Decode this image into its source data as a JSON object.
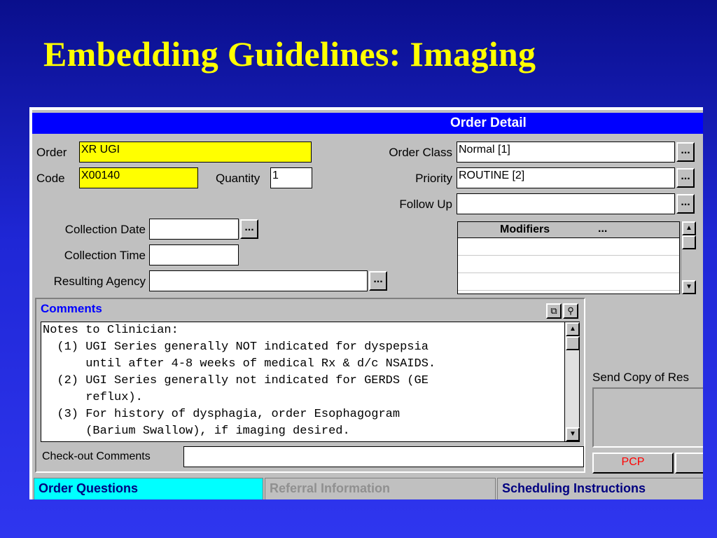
{
  "slide": {
    "title": "Embedding Guidelines: Imaging"
  },
  "window": {
    "title": "Order Detail",
    "order": {
      "label": "Order",
      "value": "XR UGI"
    },
    "code": {
      "label": "Code",
      "value": "X00140"
    },
    "quantity": {
      "label": "Quantity",
      "value": "1"
    },
    "order_class": {
      "label": "Order Class",
      "value": "Normal [1]"
    },
    "priority": {
      "label": "Priority",
      "value": "ROUTINE [2]"
    },
    "follow_up": {
      "label": "Follow Up",
      "value": ""
    },
    "collection_date": {
      "label": "Collection Date",
      "value": ""
    },
    "collection_time": {
      "label": "Collection Time",
      "value": ""
    },
    "resulting_agency": {
      "label": "Resulting Agency",
      "value": ""
    },
    "ellipsis": "...",
    "modifiers": {
      "header": "Modifiers",
      "header_dots": "..."
    },
    "comments": {
      "title": "Comments",
      "text": "Notes to Clinician:\n  (1) UGI Series generally NOT indicated for dyspepsia\n      until after 4-8 weeks of medical Rx & d/c NSAIDS.\n  (2) UGI Series generally not indicated for GERDS (GE\n      reflux).\n  (3) For history of dysphagia, order Esophagogram\n      (Barium Swallow), if imaging desired."
    },
    "checkout_comments": {
      "label": "Check-out Comments",
      "value": ""
    },
    "send_copy": {
      "label": "Send Copy of Res"
    },
    "pcp_button": "PCP",
    "tabs": [
      {
        "label": "Order Questions",
        "state": "active"
      },
      {
        "label": "Referral Information",
        "state": "disabled"
      },
      {
        "label": "Scheduling Instructions",
        "state": "normal"
      }
    ]
  },
  "colors": {
    "background": "#1f27d6",
    "title_text": "#ffff00",
    "titlebar": "#0000ff",
    "required_field": "#ffff00",
    "active_tab": "#00ffff",
    "pcp_text": "#ff0000"
  }
}
